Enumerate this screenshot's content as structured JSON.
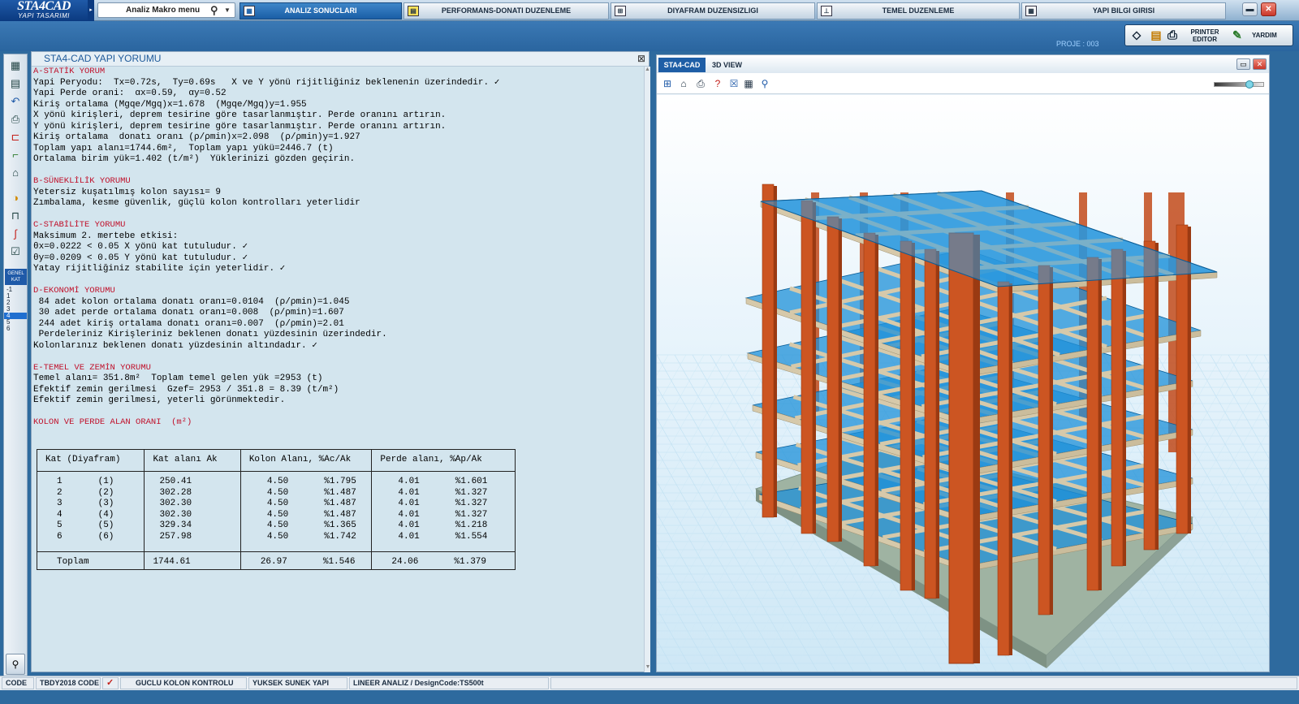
{
  "app": {
    "logo_main": "STA4CAD",
    "logo_sub": "YAPI TASARIMI"
  },
  "topbar": {
    "macro_label": "Analiz Makro menu",
    "tabs": [
      {
        "label": "ANALIZ SONUCLARI"
      },
      {
        "label": "PERFORMANS-DONATI DUZENLEME"
      },
      {
        "label": "DIYAFRAM DUZENSIZLIGI"
      },
      {
        "label": "TEMEL DUZENLEME"
      },
      {
        "label": "YAPI BILGI GIRISI"
      }
    ]
  },
  "proje": "PROJE : 003",
  "tools": {
    "printer_editor": "PRINTER EDITOR",
    "yardim": "YARDIM"
  },
  "left_toolbar": {
    "genel_kat": "GENEL KAT",
    "katlar": [
      "-1",
      "1",
      "2",
      "3",
      "4",
      "5",
      "6"
    ],
    "selected_kat": "4",
    "bottom": "ALL"
  },
  "report": {
    "title": "STA4-CAD YAPI YORUMU",
    "lines": [
      {
        "t": "A-STATİK YORUM",
        "h": true
      },
      {
        "t": "Yapi Peryodu:  Tx=0.72s,  Ty=0.69s   X ve Y yönü rijitliğiniz beklenenin üzerindedir. ✓"
      },
      {
        "t": "Yapi Perde orani:  αx=0.59,  αy=0.52"
      },
      {
        "t": "Kiriş ortalama (Mgqe/Mgq)x=1.678  (Mgqe/Mgq)y=1.955"
      },
      {
        "t": "X yönü kirişleri, deprem tesirine göre tasarlanmıştır. Perde oranını artırın."
      },
      {
        "t": "Y yönü kirişleri, deprem tesirine göre tasarlanmıştır. Perde oranını artırın."
      },
      {
        "t": "Kiriş ortalama  donatı oranı (ρ/ρmin)x=2.098  (ρ/ρmin)y=1.927"
      },
      {
        "t": "Toplam yapı alanı=1744.6m²,  Toplam yapı yükü=2446.7 (t)"
      },
      {
        "t": "Ortalama birim yük=1.402 (t/m²)  Yüklerinizi gözden geçirin."
      },
      {
        "t": ""
      },
      {
        "t": "B-SÜNEKLİLİK YORUMU",
        "h": true
      },
      {
        "t": "Yetersiz kuşatılmış kolon sayısı= 9"
      },
      {
        "t": "Zımbalama, kesme güvenlik, güçlü kolon kontrolları yeterlidir"
      },
      {
        "t": ""
      },
      {
        "t": "C-STABİLİTE YORUMU",
        "h": true
      },
      {
        "t": "Maksimum 2. mertebe etkisi:"
      },
      {
        "t": "θx=0.0222 < 0.05 X yönü kat tutuludur. ✓"
      },
      {
        "t": "θy=0.0209 < 0.05 Y yönü kat tutuludur. ✓"
      },
      {
        "t": "Yatay rijitliğiniz stabilite için yeterlidir. ✓"
      },
      {
        "t": ""
      },
      {
        "t": "D-EKONOMİ YORUMU",
        "h": true
      },
      {
        "t": " 84 adet kolon ortalama donatı oranı=0.0104  (ρ/ρmin)=1.045"
      },
      {
        "t": " 30 adet perde ortalama donatı oranı=0.008  (ρ/ρmin)=1.607"
      },
      {
        "t": " 244 adet kiriş ortalama donatı oranı=0.007  (ρ/ρmin)=2.01"
      },
      {
        "t": " Perdeleriniz Kirişleriniz beklenen donatı yüzdesinin üzerindedir."
      },
      {
        "t": "Kolonlarınız beklenen donatı yüzdesinin altındadır. ✓"
      },
      {
        "t": ""
      },
      {
        "t": "E-TEMEL VE ZEMİN YORUMU",
        "h": true
      },
      {
        "t": "Temel alanı= 351.8m²  Toplam temel gelen yük =2953 (t)"
      },
      {
        "t": "Efektif zemin gerilmesi  Gzef= 2953 / 351.8 = 8.39 (t/m²)"
      },
      {
        "t": "Efektif zemin gerilmesi, yeterli görünmektedir."
      },
      {
        "t": ""
      },
      {
        "t": "KOLON VE PERDE ALAN ORANI  (m²)",
        "h": true
      }
    ],
    "table": {
      "headers": [
        "Kat  (Diyafram)",
        "Kat alanı Ak",
        "Kolon Alanı,  %Ac/Ak",
        "Perde alanı,  %Ap/Ak"
      ],
      "rows": [
        {
          "kat": "1",
          "d": "(1)",
          "ak": "250.41",
          "ka": "4.50",
          "kp": "%1.795",
          "pa": "4.01",
          "pp": "%1.601"
        },
        {
          "kat": "2",
          "d": "(2)",
          "ak": "302.28",
          "ka": "4.50",
          "kp": "%1.487",
          "pa": "4.01",
          "pp": "%1.327"
        },
        {
          "kat": "3",
          "d": "(3)",
          "ak": "302.30",
          "ka": "4.50",
          "kp": "%1.487",
          "pa": "4.01",
          "pp": "%1.327"
        },
        {
          "kat": "4",
          "d": "(4)",
          "ak": "302.30",
          "ka": "4.50",
          "kp": "%1.487",
          "pa": "4.01",
          "pp": "%1.327"
        },
        {
          "kat": "5",
          "d": "(5)",
          "ak": "329.34",
          "ka": "4.50",
          "kp": "%1.365",
          "pa": "4.01",
          "pp": "%1.218"
        },
        {
          "kat": "6",
          "d": "(6)",
          "ak": "257.98",
          "ka": "4.50",
          "kp": "%1.742",
          "pa": "4.01",
          "pp": "%1.554"
        }
      ],
      "total": {
        "label": "Toplam",
        "ak": "1744.61",
        "ka": "26.97",
        "kp": "%1.546",
        "pa": "24.06",
        "pp": "%1.379"
      }
    }
  },
  "view3d": {
    "tab1": "STA4-CAD",
    "tab2": "3D VIEW"
  },
  "colors": {
    "column": "#cc5522",
    "beam": "#d6c9aa",
    "slab": "#1e90d8",
    "base": "#9fb3a2",
    "accent": "#1f5aa8"
  },
  "statusbar": [
    "CODE",
    "TBDY2018 CODE",
    "GUCLU KOLON KONTROLU",
    "YUKSEK SUNEK YAPI",
    "LINEER ANALIZ / DesignCode:TS500t"
  ]
}
